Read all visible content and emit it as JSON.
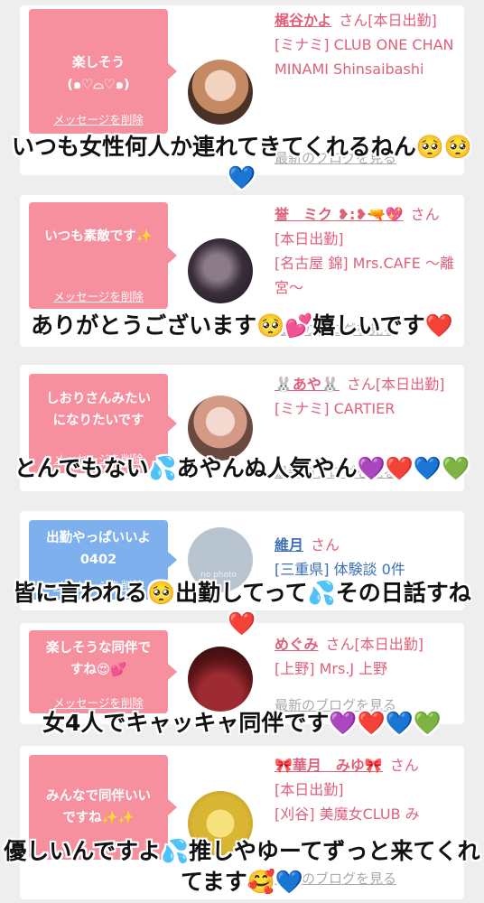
{
  "cards": [
    {
      "message": "楽しそう\n(๑♡⌓♡๑)",
      "delete_label": "メッセージを削除",
      "name": "梶谷かよ",
      "san": "さん",
      "status": "[本日出勤]",
      "shop": "[ミナミ] CLUB ONE CHAN MINAMI Shinsaibashi",
      "blog": "最新のブログを見る"
    },
    {
      "message": "いつも素敵です✨",
      "delete_label": "メッセージを削除",
      "name": "誉　ミク ❥:❥🔫💖",
      "san": "さん",
      "status": "[本日出勤]",
      "shop": "[名古屋 錦] Mrs.CAFE 〜離宮〜",
      "blog": "最新のブログを見る"
    },
    {
      "message": "しおりさんみたい\nになりたいです",
      "delete_label": "メッセージを削除",
      "name": "🐰あや🐰",
      "san": "さん",
      "status": "[本日出勤]",
      "shop": "[ミナミ] CARTIER",
      "blog": "最新のブログを見る"
    },
    {
      "message": "出勤やっぱいいよ\n0402",
      "delete_label": "メッセージを削除",
      "name": "維月",
      "san": "さん",
      "status": "",
      "shop": "[三重県] 体験談 0件",
      "blog": "",
      "avatar_text": "no photo"
    },
    {
      "message": "楽しそうな同伴で\nすね😍💕",
      "delete_label": "メッセージを削除",
      "name": "めぐみ",
      "san": "さん",
      "status": "[本日出勤]",
      "shop": "[上野] Mrs.J 上野",
      "blog": "最新のブログを見る"
    },
    {
      "message": "みんなで同伴いい\nですね✨✨",
      "delete_label": "メッセージを削除",
      "name": "🎀華月　みゆ🎀",
      "san": "さん",
      "status": "[本日出勤]",
      "shop": "[刈谷] 美魔女CLUB み",
      "blog": "最新のブログを見る"
    }
  ],
  "captions": [
    "いつも女性何人か連れてきてくれるねん🥺🥺💙",
    "ありがとうございます🥺💕嬉しいです❤️",
    "とんでもない💦あやんぬ人気やん💜❤️💙💚",
    "皆に言われる🥺出勤してって💦その日話すね❤️",
    "女4人でキャッキャ同伴です💜❤️💙💚",
    "優しいんですよ💦推しやゆーてずっと来てくれてます🥰💙"
  ],
  "colors": {
    "bubble_pink": "#f6909f",
    "bubble_blue": "#7fb0ee",
    "name_pink": "#e0607a",
    "name_blue": "#3b6fb6"
  }
}
